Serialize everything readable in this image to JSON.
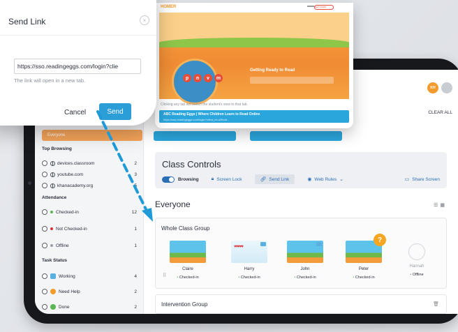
{
  "modal": {
    "title": "Send Link",
    "close_glyph": "×",
    "url_value": "https://sso.readingeggs.com/login?clie",
    "hint": "The link will open in a new tab.",
    "cancel_label": "Cancel",
    "send_label": "Send"
  },
  "popup": {
    "logo": "HOMER",
    "nav_button": "GET LOGIN",
    "hero_text": "Getting Ready to Read",
    "letters": [
      "p",
      "n",
      "v",
      "m"
    ],
    "caption": "Clicking any tab will switch the student's view to that tab.",
    "link_title": "ABC Reading Eggs | Where Children Learn to Read Online",
    "link_url": "https://sso.readingeggs.com/login?client_id=a3fbdd..."
  },
  "header": {
    "avatar_initials": "KH",
    "clear_all": "CLEAR ALL"
  },
  "sidebar": {
    "everyone_label": "Everyone",
    "top_browsing_title": "Top Browsing",
    "top_browsing": [
      {
        "label": "devices.classroom",
        "count": "2"
      },
      {
        "label": "youtube.com",
        "count": "3"
      },
      {
        "label": "khanacademy.org",
        "count": "5"
      }
    ],
    "attendance_title": "Attendance",
    "attendance": [
      {
        "label": "Checked-in",
        "count": "12",
        "color": "#5ab552"
      },
      {
        "label": "Not Checked-in",
        "count": "1",
        "color": "#d8323b"
      },
      {
        "label": "Offline",
        "count": "1",
        "color": "#9aa0a8"
      }
    ],
    "task_status_title": "Task Status",
    "task_status": [
      {
        "label": "Working",
        "count": "4"
      },
      {
        "label": "Need Help",
        "count": "2"
      },
      {
        "label": "Done",
        "count": "2"
      }
    ]
  },
  "controls": {
    "title": "Class Controls",
    "browsing": "Browsing",
    "screen_lock": "Screen Lock",
    "send_link": "Send Link",
    "web_rules": "Web Rules",
    "share_screen": "Share Screen"
  },
  "everyone_title": "Everyone",
  "whole_group": {
    "title": "Whole Class Group",
    "students": [
      {
        "name": "Claire",
        "status": "Checked-in"
      },
      {
        "name": "Harry",
        "status": "Checked-in"
      },
      {
        "name": "John",
        "status": "Checked-in"
      },
      {
        "name": "Peter",
        "status": "Checked-in"
      },
      {
        "name": "Hannah",
        "status": "Offline"
      }
    ],
    "help_glyph": "?"
  },
  "intervention_title": "Intervention Group",
  "colors": {
    "accent_blue": "#2b9ed8",
    "orange": "#f5a45a",
    "green": "#5ab552"
  }
}
